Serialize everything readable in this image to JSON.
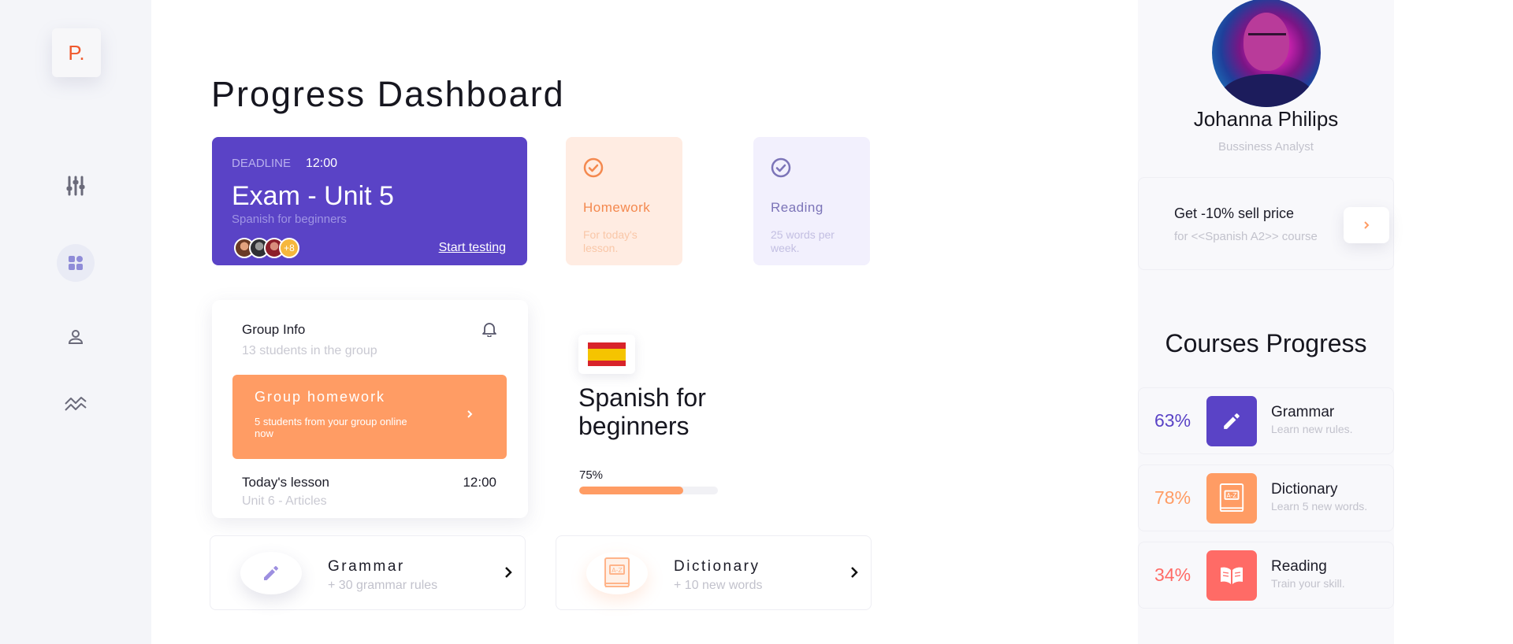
{
  "brand": {
    "logo_text": "P."
  },
  "sidebar": {
    "items": [
      {
        "name": "sliders",
        "icon": "sliders-icon",
        "active": false
      },
      {
        "name": "dashboard",
        "icon": "dashboard-grid-icon",
        "active": true
      },
      {
        "name": "profile",
        "icon": "user-icon",
        "active": false
      },
      {
        "name": "stats",
        "icon": "trend-chart-icon",
        "active": false
      }
    ]
  },
  "main": {
    "title": "Progress Dashboard",
    "exam_card": {
      "deadline_label": "DEADLINE",
      "deadline_time": "12:00",
      "title": "Exam - Unit 5",
      "subtitle": "Spanish for beginners",
      "extra_participants": "+8",
      "action_label": "Start testing",
      "color": "#5a43c6"
    },
    "homework_card": {
      "title": "Homework",
      "subtitle": "For today's lesson.",
      "icon": "check-circle-icon"
    },
    "reading_card": {
      "title": "Reading",
      "subtitle": "25 words per week.",
      "icon": "check-circle-icon"
    },
    "group_card": {
      "title": "Group Info",
      "subtitle": "13 students in the group",
      "group_homework": {
        "title": "Group homework",
        "subtitle": "5 students from your group online now"
      },
      "lesson_title": "Today's lesson",
      "lesson_time": "12:00",
      "lesson_subtitle": "Unit 6 - Articles"
    },
    "course": {
      "flag": "spain-flag-icon",
      "title": "Spanish for beginners",
      "progress_label": "75%",
      "progress": 0.75
    },
    "bottom_cards": [
      {
        "title": "Grammar",
        "subtitle": "+ 30 grammar rules",
        "icon": "pencil-icon"
      },
      {
        "title": "Dictionary",
        "subtitle": "+ 10 new words",
        "icon": "dictionary-book-icon"
      }
    ]
  },
  "profile": {
    "name": "Johanna Philips",
    "role": "Bussiness Analyst",
    "promo_title": "Get -10% sell price",
    "promo_subtitle": "for <<Spanish A2>> course"
  },
  "courses_progress": {
    "title": "Courses Progress",
    "items": [
      {
        "percent": "63%",
        "title": "Grammar",
        "subtitle": "Learn new rules.",
        "color": "#5a43c6",
        "icon": "pencil-icon"
      },
      {
        "percent": "78%",
        "title": "Dictionary",
        "subtitle": "Learn 5 new words.",
        "color": "#ff9c64",
        "icon": "dictionary-book-icon"
      },
      {
        "percent": "34%",
        "title": "Reading",
        "subtitle": "Train your skill.",
        "color": "#ff6b66",
        "icon": "open-book-icon"
      }
    ]
  },
  "colors": {
    "accent_purple": "#5a43c6",
    "accent_orange": "#ff9c64",
    "accent_red": "#ff6b66"
  }
}
